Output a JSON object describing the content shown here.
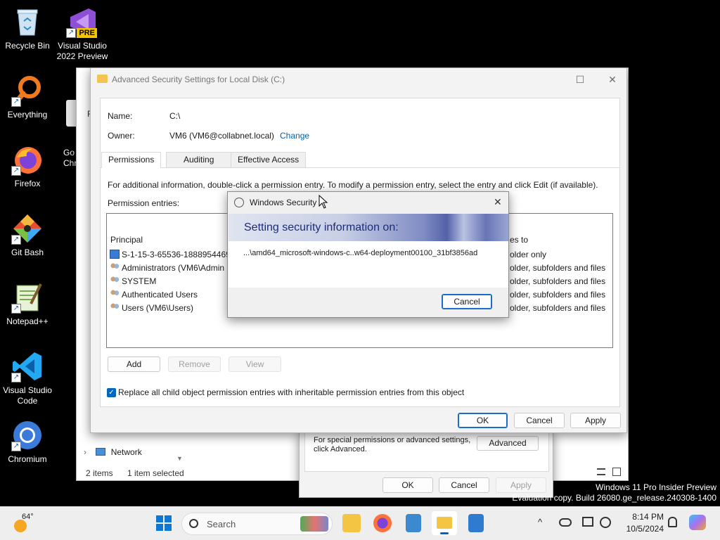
{
  "desktop": {
    "icons": [
      {
        "label": "Recycle Bin"
      },
      {
        "label": "Visual Studio 2022 Preview",
        "badge": "PRE"
      },
      {
        "label": "Everything"
      },
      {
        "label": "Firefox"
      },
      {
        "label": "Git Bash"
      },
      {
        "label": "Notepad++"
      },
      {
        "label": "Visual Studio Code"
      },
      {
        "label": "Chromium"
      }
    ],
    "partial_icon_text": "Go\nChr",
    "partial_letter": "F",
    "watermark_line1": "Windows 11 Pro Insider Preview",
    "watermark_line2": "Evaluation copy. Build 26080.ge_release.240308-1400"
  },
  "explorer": {
    "nav_item": "Network",
    "status_items": "2 items",
    "status_selected": "1 item selected"
  },
  "props_dialog": {
    "special_text": "For special permissions or advanced settings, click Advanced.",
    "advanced_button": "Advanced",
    "ok": "OK",
    "cancel": "Cancel",
    "apply": "Apply"
  },
  "adv": {
    "title": "Advanced Security Settings for Local Disk (C:)",
    "name_label": "Name:",
    "name_value": "C:\\",
    "owner_label": "Owner:",
    "owner_value": "VM6 (VM6@collabnet.local)",
    "change_link": "Change",
    "tabs": [
      "Permissions",
      "Auditing",
      "Effective Access"
    ],
    "info_text": "For additional information, double-click a permission entry. To modify a permission entry, select the entry and click Edit (if available).",
    "entries_label": "Permission entries:",
    "col_principal": "Principal",
    "col_applies_partial": "es to",
    "principals": [
      "S-1-15-3-65536-1888954469-",
      "Administrators (VM6\\Admin",
      "SYSTEM",
      "Authenticated Users",
      "Users (VM6\\Users)"
    ],
    "applies": [
      "older only",
      "older, subfolders and files",
      "older, subfolders and files",
      "older, subfolders and files",
      "older, subfolders and files"
    ],
    "add": "Add",
    "remove": "Remove",
    "view": "View",
    "replace_checkbox": "Replace all child object permission entries with inheritable permission entries from this object",
    "replace_checked": true,
    "ok": "OK",
    "cancel": "Cancel",
    "apply": "Apply"
  },
  "security_dialog": {
    "title": "Windows Security",
    "heading": "Setting security information on:",
    "path": "...\\amd64_microsoft-windows-c..w64-deployment00100_31bf3856ad",
    "cancel": "Cancel"
  },
  "taskbar": {
    "weather_temp": "64°",
    "search_placeholder": "Search",
    "time": "8:14 PM",
    "date": "10/5/2024"
  },
  "colors": {
    "accent": "#0067c0",
    "link": "#0063b1"
  }
}
